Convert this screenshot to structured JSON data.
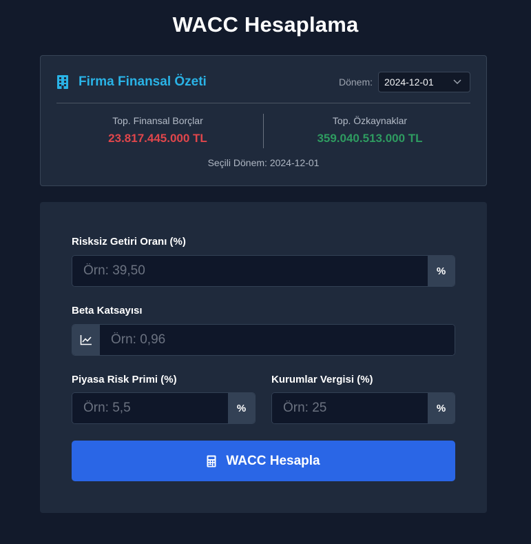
{
  "page": {
    "title": "WACC Hesaplama"
  },
  "summary": {
    "title": "Firma Finansal Özeti",
    "period_label": "Dönem:",
    "period_value": "2024-12-01",
    "debt_label": "Top. Finansal Borçlar",
    "debt_value": "23.817.445.000 TL",
    "equity_label": "Top. Özkaynaklar",
    "equity_value": "359.040.513.000 TL",
    "selected_period_text": "Seçili Dönem: 2024-12-01"
  },
  "form": {
    "risk_free": {
      "label": "Risksiz Getiri Oranı (%)",
      "placeholder": "Örn: 39,50",
      "suffix": "%"
    },
    "beta": {
      "label": "Beta Katsayısı",
      "placeholder": "Örn: 0,96",
      "icon": "chart-line-icon"
    },
    "market_premium": {
      "label": "Piyasa Risk Primi (%)",
      "placeholder": "Örn: 5,5",
      "suffix": "%"
    },
    "tax_rate": {
      "label": "Kurumlar Vergisi (%)",
      "placeholder": "Örn: 25",
      "suffix": "%"
    },
    "submit_label": "WACC Hesapla"
  },
  "colors": {
    "background": "#121a2b",
    "card": "#1f2a3c",
    "accent_title": "#2ab3e6",
    "debt": "#e0464b",
    "equity": "#2e9b60",
    "button": "#2a66e6"
  }
}
